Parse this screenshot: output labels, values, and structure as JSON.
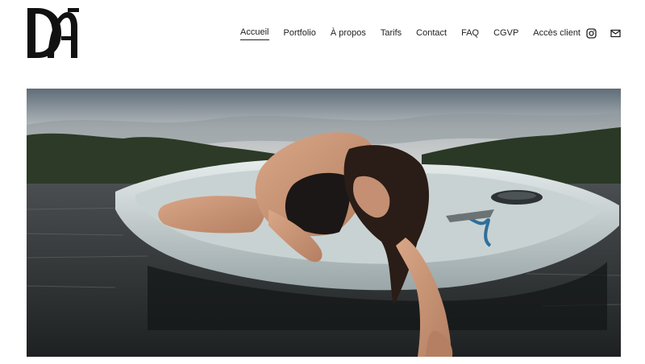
{
  "brand": {
    "logo_icon": "monogram-dm-logo"
  },
  "nav": {
    "items": [
      {
        "label": "Accueil",
        "active": true
      },
      {
        "label": "Portfolio",
        "active": false
      },
      {
        "label": "À propos",
        "active": false
      },
      {
        "label": "Tarifs",
        "active": false
      },
      {
        "label": "Contact",
        "active": false
      },
      {
        "label": "FAQ",
        "active": false
      },
      {
        "label": "CGVP",
        "active": false
      },
      {
        "label": "Accès client",
        "active": false
      }
    ],
    "icons": [
      "instagram-icon",
      "mail-icon"
    ]
  },
  "hero": {
    "image": "photo-woman-in-white-boat-on-lake"
  },
  "colors": {
    "text": "#222222",
    "background": "#ffffff"
  }
}
